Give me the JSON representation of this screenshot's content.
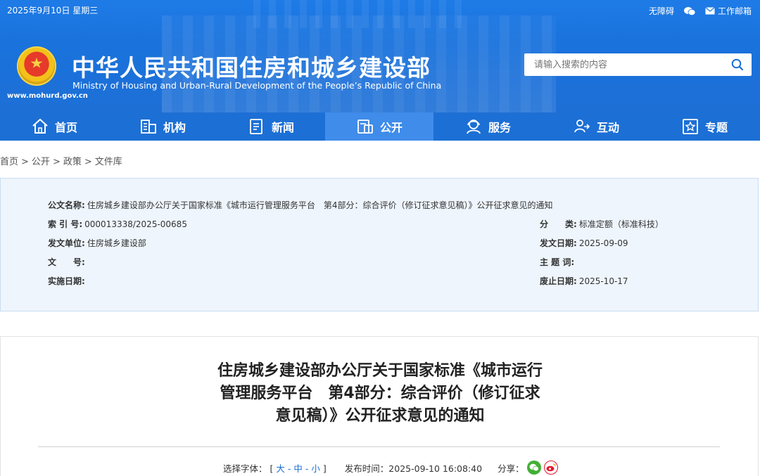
{
  "topbar": {
    "date": "2025年9月10日 星期三",
    "accessibility": "无障碍",
    "email": "工作邮箱"
  },
  "header": {
    "url": "www.mohurd.gov.cn",
    "title": "中华人民共和国住房和城乡建设部",
    "subtitle": "Ministry of Housing and Urban-Rural Development of the People’s Republic of China"
  },
  "search": {
    "placeholder": "请输入搜索的内容"
  },
  "nav": [
    {
      "label": "首页",
      "icon": "home-icon"
    },
    {
      "label": "机构",
      "icon": "building-icon"
    },
    {
      "label": "新闻",
      "icon": "news-icon"
    },
    {
      "label": "公开",
      "icon": "public-icon",
      "active": true
    },
    {
      "label": "服务",
      "icon": "service-icon"
    },
    {
      "label": "互动",
      "icon": "interact-icon"
    },
    {
      "label": "专题",
      "icon": "star-icon"
    }
  ],
  "breadcrumb": [
    "首页",
    "公开",
    "政策",
    "文件库"
  ],
  "meta": {
    "doc_name_label": "公文名称:",
    "doc_name": "住房城乡建设部办公厅关于国家标准《城市运行管理服务平台　第4部分：综合评价（修订征求意见稿）》公开征求意见的通知",
    "index_label": "索 引 号:",
    "index": "000013338/2025-00685",
    "category_label": "分　　类:",
    "category": "标准定额（标准科技）",
    "issuer_label": "发文单位:",
    "issuer": "住房城乡建设部",
    "issue_date_label": "发文日期:",
    "issue_date": "2025-09-09",
    "doc_no_label": "文　　号:",
    "doc_no": "",
    "subject_label": "主 题 词:",
    "subject": "",
    "effective_label": "实施日期:",
    "effective": "",
    "expiry_label": "废止日期:",
    "expiry": "2025-10-17"
  },
  "article": {
    "title_line1": "住房城乡建设部办公厅关于国家标准《城市运行",
    "title_line2": "管理服务平台　第4部分：综合评价（修订征求",
    "title_line3": "意见稿）》公开征求意见的通知",
    "font_label": "选择字体：",
    "font_open": "[",
    "font_large": "大",
    "font_mid": "中",
    "font_small": "小",
    "font_dash": "-",
    "font_close": "]",
    "pub_time_label": "发布时间：",
    "pub_time": "2025-09-10 16:08:40",
    "share_label": "分享："
  },
  "colors": {
    "brand_blue": "#1c6fd5",
    "nav_active": "#3f8cea",
    "meta_bg": "#eef5fc",
    "wechat_green": "#41b035",
    "weibo_red": "#e6162d"
  }
}
